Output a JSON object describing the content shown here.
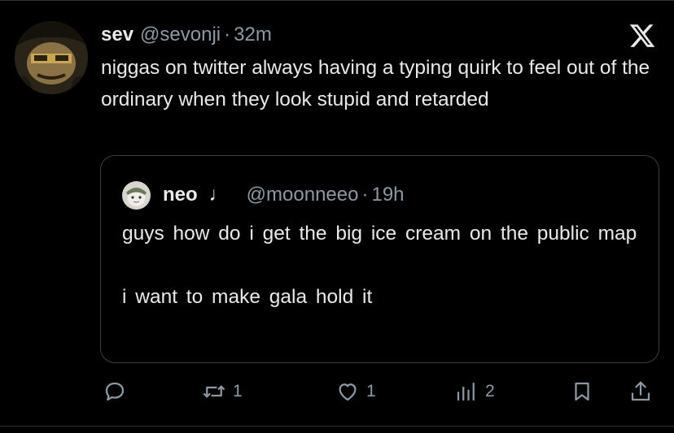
{
  "tweet": {
    "author_name": "sev",
    "author_handle": "@sevonji",
    "separator": "·",
    "time": "32m",
    "text": "niggas on twitter always having a typing quirk to feel out of the ordinary when they look stupid and retarded"
  },
  "quote": {
    "author_name": "neo",
    "name_suffix": "♩",
    "author_handle": "@moonneeo",
    "separator": "·",
    "time": "19h",
    "text": "guys how do i get the big ice cream on the public map\n\ni want to make gala hold it"
  },
  "actions": {
    "replies": "",
    "retweets": "1",
    "likes": "1",
    "views": "2"
  },
  "icons": {
    "brand": "x-logo-icon",
    "reply": "reply-icon",
    "retweet": "retweet-icon",
    "like": "heart-icon",
    "views": "views-icon",
    "bookmark": "bookmark-icon",
    "share": "share-icon"
  },
  "colors": {
    "background": "#000000",
    "text": "#e7e9ea",
    "muted": "#8b98a5",
    "border": "#3a3f44"
  }
}
